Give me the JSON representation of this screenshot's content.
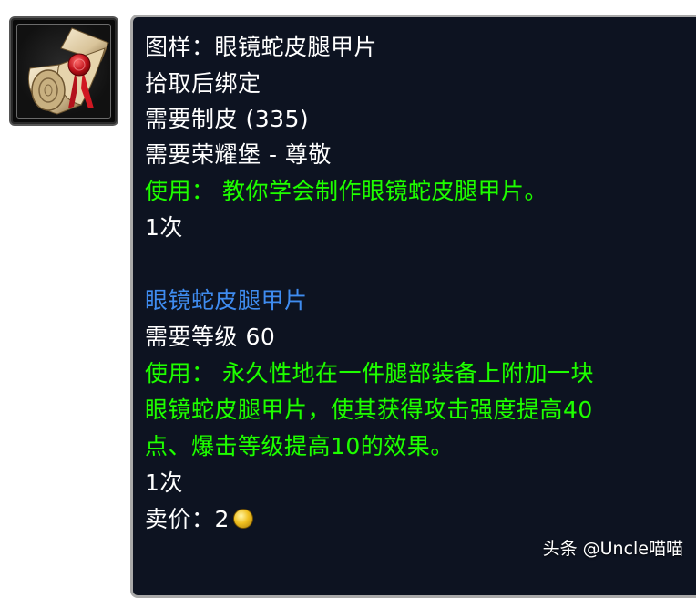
{
  "item_icon": {
    "name": "scroll-recipe-icon"
  },
  "tooltip": {
    "title": "图样：眼镜蛇皮腿甲片",
    "bind": "拾取后绑定",
    "req_skill": "需要制皮 (335)",
    "req_rep": "需要荣耀堡 - 尊敬",
    "use1": "使用：  教你学会制作眼镜蛇皮腿甲片。",
    "charges1": "1次",
    "product_name": "眼镜蛇皮腿甲片",
    "req_level": "需要等级 60",
    "use2_line1": "使用：  永久性地在一件腿部装备上附加一块",
    "use2_line2": "眼镜蛇皮腿甲片，使其获得攻击强度提高40",
    "use2_line3": "点、爆击等级提高10的效果。",
    "charges2": "1次",
    "sell_label": "卖价：",
    "sell_value": "2"
  },
  "colors": {
    "title_white": "#ffffff",
    "use_green": "#1eff00",
    "product_blue": "#3f8cf0",
    "tooltip_bg": "#0d1321",
    "gold_coin": "#f0c020"
  },
  "watermark": "头条 @Uncle喵喵"
}
